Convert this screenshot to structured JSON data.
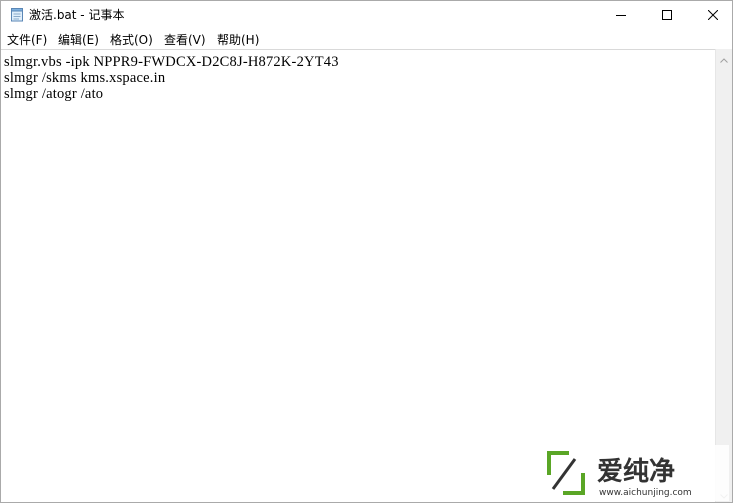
{
  "window": {
    "title": "激活.bat - 记事本",
    "icon": "notepad-icon",
    "controls": {
      "minimize_icon": "minimize-icon",
      "maximize_icon": "maximize-icon",
      "close_icon": "close-icon"
    }
  },
  "menu": {
    "items": [
      {
        "label": "文件(F)"
      },
      {
        "label": "编辑(E)"
      },
      {
        "label": "格式(O)"
      },
      {
        "label": "查看(V)"
      },
      {
        "label": "帮助(H)"
      }
    ]
  },
  "editor": {
    "lines": [
      "slmgr.vbs -ipk NPPR9-FWDCX-D2C8J-H872K-2YT43",
      "slmgr /skms kms.xspace.in",
      "slmgr /atogr /ato"
    ]
  },
  "watermark": {
    "brand": "爱纯净",
    "url": "www.aichunjing.com",
    "accent_color": "#5aa626"
  }
}
